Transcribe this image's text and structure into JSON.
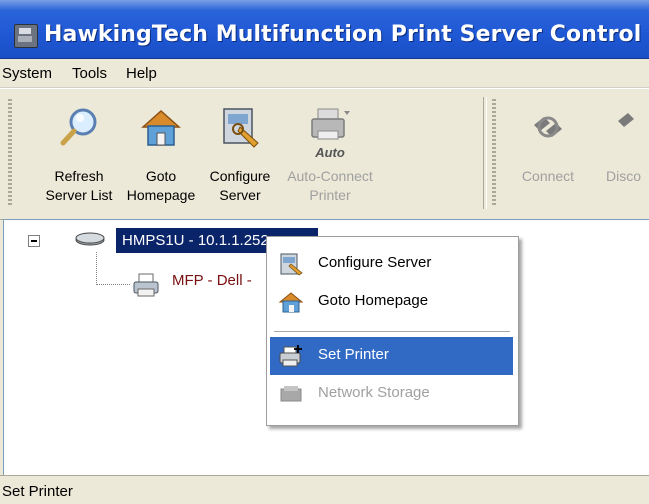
{
  "window": {
    "title": "HawkingTech Multifunction Print Server Control Center"
  },
  "menubar": {
    "items": [
      {
        "label": "System"
      },
      {
        "label": "Tools"
      },
      {
        "label": "Help"
      }
    ]
  },
  "toolbar": {
    "buttons": [
      {
        "label": "Refresh\nServer List",
        "icon": "magnifier-icon",
        "enabled": true
      },
      {
        "label": "Goto\nHomepage",
        "icon": "home-icon",
        "enabled": true
      },
      {
        "label": "Configure\nServer",
        "icon": "configure-server-icon",
        "enabled": true
      },
      {
        "label": "Auto-Connect\nPrinter",
        "icon": "auto-printer-icon",
        "overlay_text": "Auto",
        "enabled": false
      },
      {
        "label": "Connect",
        "icon": "connect-icon",
        "enabled": false
      },
      {
        "label": "Disco",
        "icon": "disconnect-icon",
        "enabled": false
      }
    ]
  },
  "tree": {
    "server": {
      "label": "HMPS1U - 10.1.1.252",
      "selected": true,
      "expanded": true
    },
    "printer": {
      "label": "MFP - Dell - "
    }
  },
  "context_menu": {
    "items": [
      {
        "label": "Configure Server",
        "icon": "configure-server-icon",
        "state": "normal"
      },
      {
        "label": "Goto Homepage",
        "icon": "home-icon",
        "state": "normal"
      },
      {
        "label": "Set Printer",
        "icon": "set-printer-icon",
        "state": "highlighted"
      },
      {
        "label": "Network Storage",
        "icon": "network-storage-icon",
        "state": "disabled"
      }
    ]
  },
  "statusbar": {
    "text": "Set Printer"
  },
  "colors": {
    "titlebar": "#2a64d9",
    "selection": "#0a246a",
    "menu_highlight": "#316ac5",
    "printer_label": "#7a1010"
  }
}
